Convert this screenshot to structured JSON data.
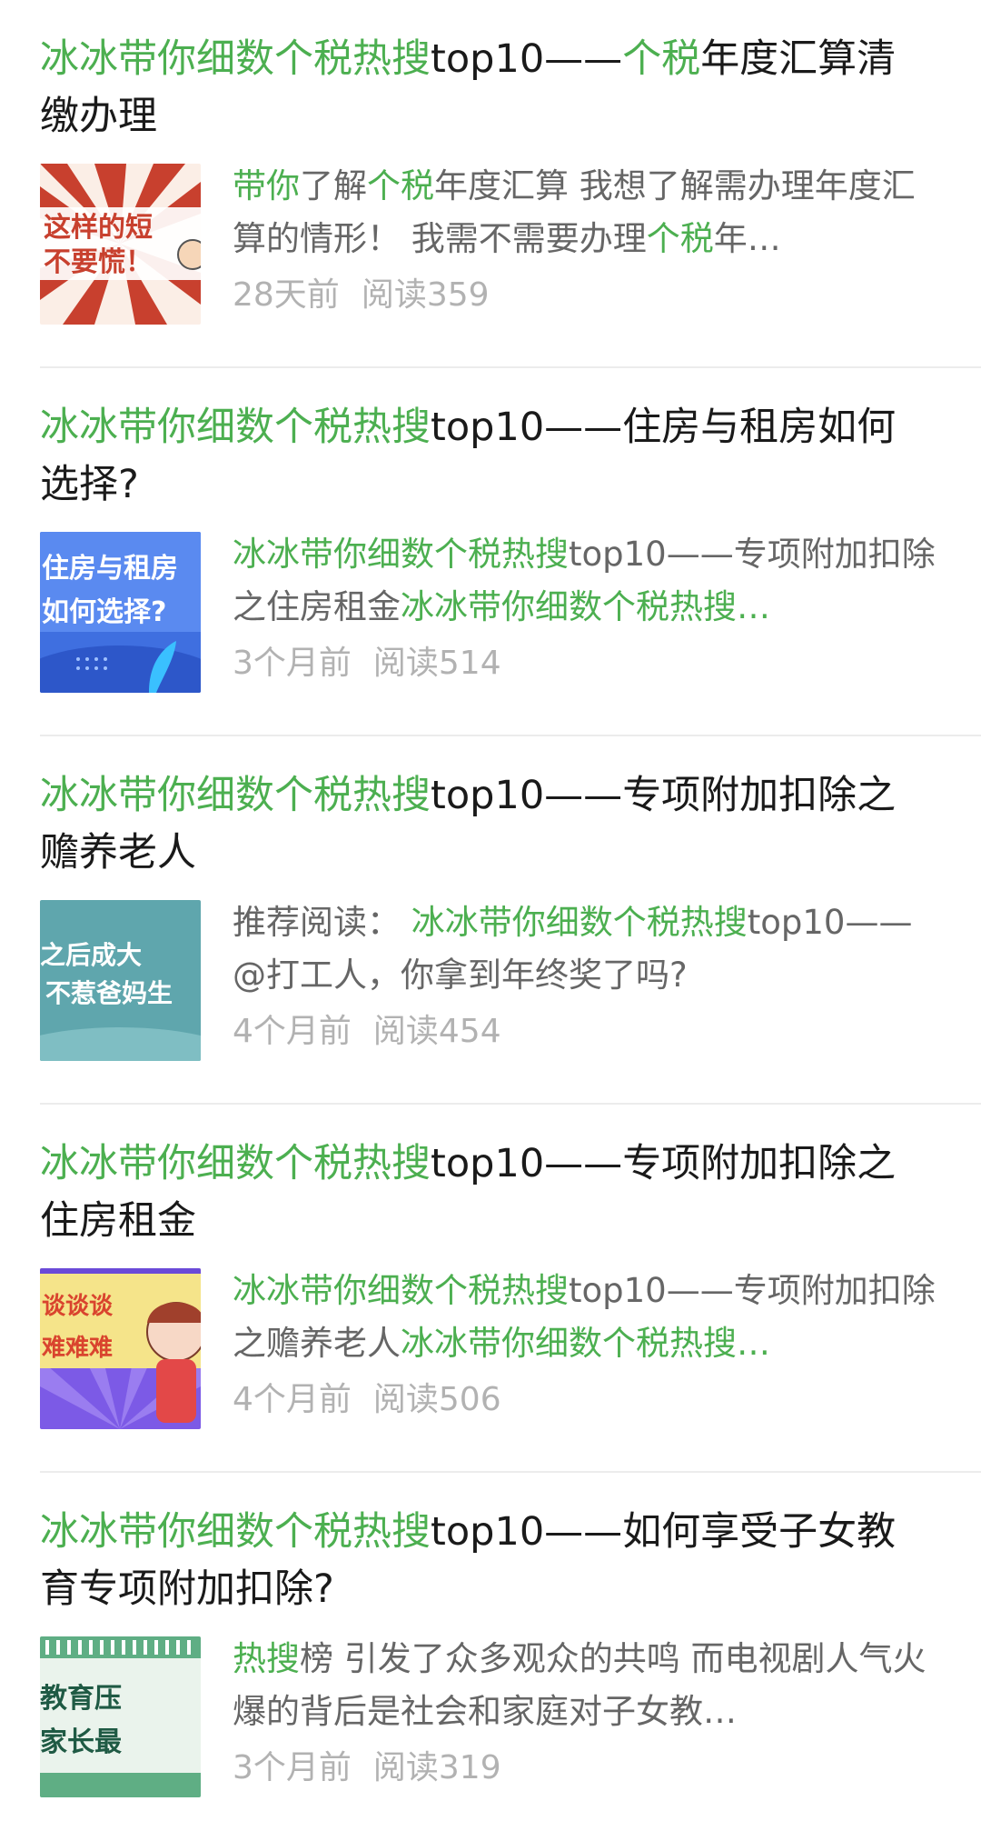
{
  "articles": [
    {
      "title_hl": "冰冰带你细数个税热搜",
      "title_mid": "top10——",
      "title_hl2": "个税",
      "title_rest": "年度汇算清缴办理",
      "digest_parts": [
        {
          "t": "带你",
          "hl": true
        },
        {
          "t": "了解",
          "hl": false
        },
        {
          "t": "个税",
          "hl": true
        },
        {
          "t": "年度汇算 我想了解需办理年度汇算的情形！ 我需不需要办理",
          "hl": false
        },
        {
          "t": "个税",
          "hl": true
        },
        {
          "t": "年…",
          "hl": false
        }
      ],
      "time": "28天前",
      "reads": "阅读359",
      "thumb_text": [
        "这样的短",
        "不要慌！"
      ]
    },
    {
      "title_hl": "冰冰带你细数个税热搜",
      "title_mid": "top10——",
      "title_hl2": "",
      "title_rest": "住房与租房如何选择?",
      "digest_parts": [
        {
          "t": "冰冰带你细数个税热搜",
          "hl": true
        },
        {
          "t": "top10——专项附加扣除之住房租金",
          "hl": false
        },
        {
          "t": "冰冰带你细数个税热搜…",
          "hl": true
        }
      ],
      "time": "3个月前",
      "reads": "阅读514",
      "thumb_text": [
        "住房与租房",
        "如何选择?"
      ]
    },
    {
      "title_hl": "冰冰带你细数个税热搜",
      "title_mid": "top10——",
      "title_hl2": "",
      "title_rest": "专项附加扣除之赡养老人",
      "digest_parts": [
        {
          "t": "推荐阅读： ",
          "hl": false
        },
        {
          "t": "冰冰带你细数个税热搜",
          "hl": true
        },
        {
          "t": "top10——@打工人，你拿到年终奖了吗?",
          "hl": false
        }
      ],
      "time": "4个月前",
      "reads": "阅读454",
      "thumb_text": [
        "之后成大",
        "不惹爸妈生"
      ]
    },
    {
      "title_hl": "冰冰带你细数个税热搜",
      "title_mid": "top10——",
      "title_hl2": "",
      "title_rest": "专项附加扣除之住房租金",
      "digest_parts": [
        {
          "t": "冰冰带你细数个税热搜",
          "hl": true
        },
        {
          "t": "top10——专项附加扣除之赡养老人",
          "hl": false
        },
        {
          "t": "冰冰带你细数个税热搜…",
          "hl": true
        }
      ],
      "time": "4个月前",
      "reads": "阅读506",
      "thumb_text": [
        "谈谈谈",
        "难难难"
      ]
    },
    {
      "title_hl": "冰冰带你细数个税热搜",
      "title_mid": "top10——",
      "title_hl2": "",
      "title_rest": "如何享受子女教育专项附加扣除?",
      "digest_parts": [
        {
          "t": "热搜",
          "hl": true
        },
        {
          "t": "榜 引发了众多观众的共鸣 而电视剧人气火爆的背后是社会和家庭对子女教…",
          "hl": false
        }
      ],
      "time": "3个月前",
      "reads": "阅读319",
      "thumb_text": [
        "教育压",
        "家长最"
      ]
    }
  ],
  "colors": {
    "highlight": "#4caf50",
    "title": "#1a1a1a",
    "digest": "#666666",
    "meta": "#b2b2b2",
    "divider": "#ececec"
  }
}
